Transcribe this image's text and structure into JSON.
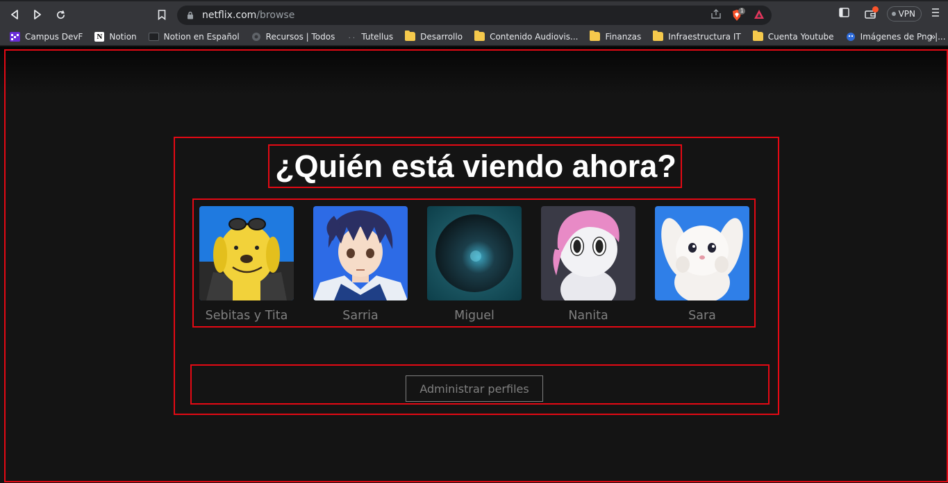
{
  "browser": {
    "url_domain": "netflix.com",
    "url_path": "/browse",
    "brave_badge": "1",
    "vpn_label": "VPN",
    "bookmarks": [
      {
        "label": "Campus DevF",
        "icon": "campus-devf-icon"
      },
      {
        "label": "Notion",
        "icon": "notion-icon"
      },
      {
        "label": "Notion en Español",
        "icon": "notion-es-icon"
      },
      {
        "label": "Recursos | Todos",
        "icon": "globe-icon"
      },
      {
        "label": "Tutellus",
        "icon": "tutellus-icon"
      },
      {
        "label": "Desarrollo",
        "icon": "folder-icon"
      },
      {
        "label": "Contenido Audiovis...",
        "icon": "folder-icon"
      },
      {
        "label": "Finanzas",
        "icon": "folder-icon"
      },
      {
        "label": "Infraestructura IT",
        "icon": "folder-icon"
      },
      {
        "label": "Cuenta Youtube",
        "icon": "folder-icon"
      },
      {
        "label": "Imágenes de Png |...",
        "icon": "png-images-icon"
      }
    ],
    "more_bookmarks": "»"
  },
  "page": {
    "heading": "¿Quién está viendo ahora?",
    "profiles": [
      {
        "name": "Sebitas y Tita",
        "avatar": "yellow-dog-avatar"
      },
      {
        "name": "Sarria",
        "avatar": "anime-boy-avatar"
      },
      {
        "name": "Miguel",
        "avatar": "dark-planet-avatar"
      },
      {
        "name": "Nanita",
        "avatar": "pink-robot-avatar"
      },
      {
        "name": "Sara",
        "avatar": "white-bunny-avatar"
      }
    ],
    "manage_button": "Administrar perfiles"
  },
  "colors": {
    "background": "#141414",
    "outline": "#e50914",
    "profile_name": "#808080",
    "heading": "#ffffff"
  }
}
